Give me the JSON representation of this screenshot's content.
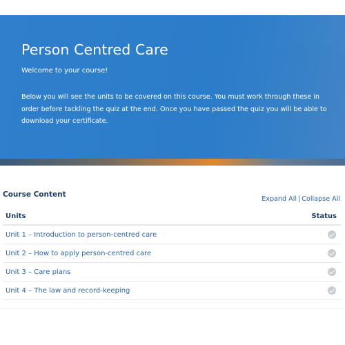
{
  "hero": {
    "title": "Person Centred Care",
    "welcome": "Welcome to your course!",
    "description": "Below you will see the units to be covered on this course. You must work through these in order before tackling the quiz at the end. Once you have passed the quiz you will be able to download your certificate."
  },
  "course_content": {
    "heading": "Course Content",
    "expand_all": "Expand All",
    "separator": "|",
    "collapse_all": "Collapse All",
    "columns": {
      "units": "Units",
      "status": "Status"
    },
    "units": [
      {
        "label": "Unit 1 – Introduction to person-centred care",
        "status_icon": "check-circle-icon"
      },
      {
        "label": "Unit 2 – How to apply person-centred care",
        "status_icon": "check-circle-icon"
      },
      {
        "label": "Unit 3 – Care plans",
        "status_icon": "check-circle-icon"
      },
      {
        "label": "Unit 4 – The law and record-keeping",
        "status_icon": "check-circle-icon"
      }
    ]
  },
  "colors": {
    "hero_blue": "#2f7fcd",
    "heading_navy": "#1f3d66",
    "link_blue": "#2c64a8",
    "check_grey": "#c8ccd0"
  }
}
